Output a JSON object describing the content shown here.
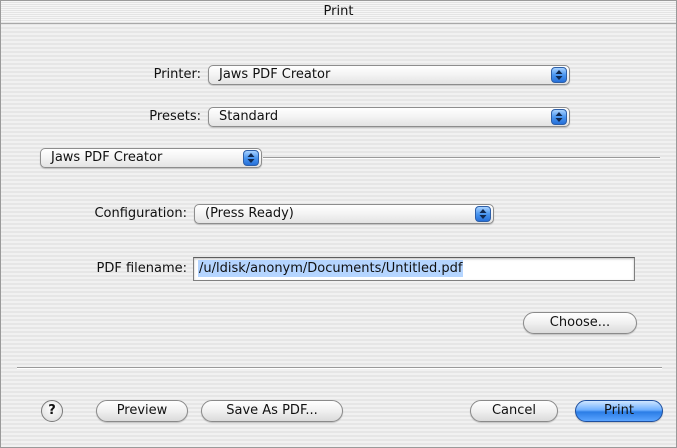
{
  "window": {
    "title": "Print"
  },
  "printer": {
    "label": "Printer:",
    "value": "Jaws PDF Creator"
  },
  "presets": {
    "label": "Presets:",
    "value": "Standard"
  },
  "panel": {
    "value": "Jaws PDF Creator"
  },
  "configuration": {
    "label": "Configuration:",
    "value": "(Press Ready)"
  },
  "pdf_filename": {
    "label": "PDF filename:",
    "value": "/u/ldisk/anonym/Documents/Untitled.pdf"
  },
  "buttons": {
    "choose": "Choose...",
    "help": "?",
    "preview": "Preview",
    "save_as_pdf": "Save As PDF...",
    "cancel": "Cancel",
    "print": "Print"
  },
  "colors": {
    "accent": "#2b7de6",
    "selection": "#b5d5ff"
  },
  "icons": [
    "updown-arrows-icon",
    "help-icon"
  ]
}
